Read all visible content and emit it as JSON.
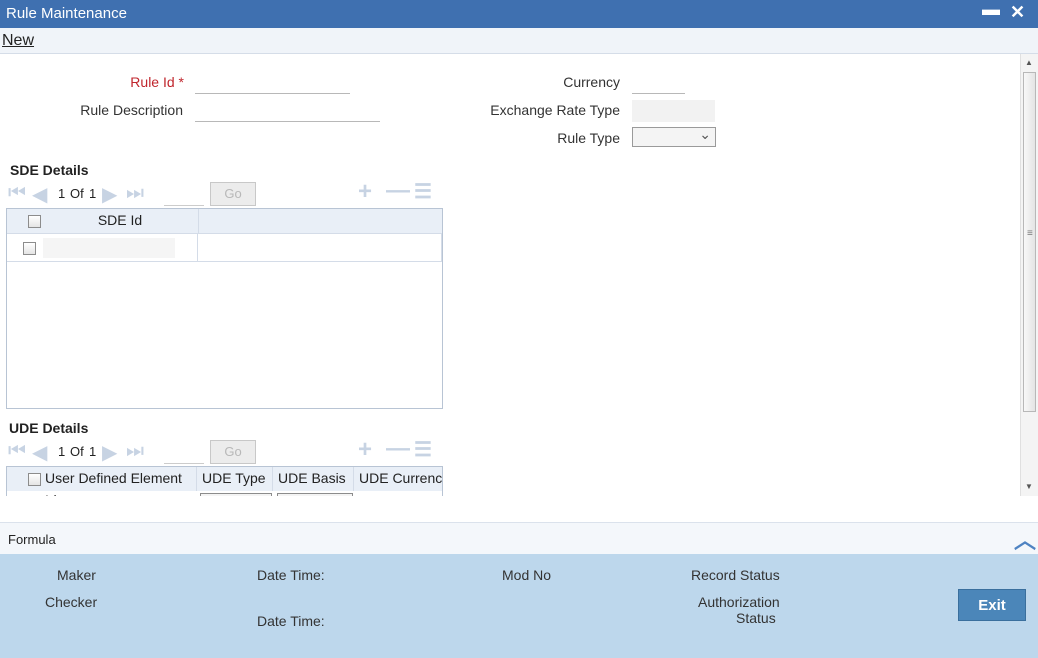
{
  "window": {
    "title": "Rule Maintenance",
    "minimize": "▬",
    "close": "✕"
  },
  "menu": {
    "new_label": "New"
  },
  "form": {
    "rule_id_label": "Rule Id",
    "rule_id_required": "*",
    "rule_id_value": "",
    "rule_description_label": "Rule Description",
    "rule_description_value": "",
    "currency_label": "Currency",
    "currency_value": "",
    "exchange_rate_type_label": "Exchange Rate Type",
    "exchange_rate_type_value": "",
    "rule_type_label": "Rule Type",
    "rule_type_value": ""
  },
  "sde": {
    "title": "SDE Details",
    "page_current": "1",
    "page_of": "Of",
    "page_total": "1",
    "go_label": "Go",
    "columns": [
      "SDE Id"
    ]
  },
  "ude": {
    "title": "UDE Details",
    "page_current": "1",
    "page_of": "Of",
    "page_total": "1",
    "go_label": "Go",
    "columns": [
      "User Defined Element Id",
      "UDE Type",
      "UDE Basis",
      "UDE Currency"
    ]
  },
  "formula": {
    "label": "Formula"
  },
  "audit": {
    "maker_label": "Maker",
    "checker_label": "Checker",
    "date_time_label_1": "Date Time:",
    "date_time_label_2": "Date Time:",
    "mod_no_label": "Mod No",
    "record_status_label": "Record Status",
    "authorization_label": "Authorization",
    "status_label": "Status",
    "exit_label": "Exit"
  },
  "colors": {
    "title_bar": "#3f70b0",
    "audit_panel": "#bdd7ec",
    "exit_button": "#4b86b9",
    "required": "#c0262d"
  }
}
